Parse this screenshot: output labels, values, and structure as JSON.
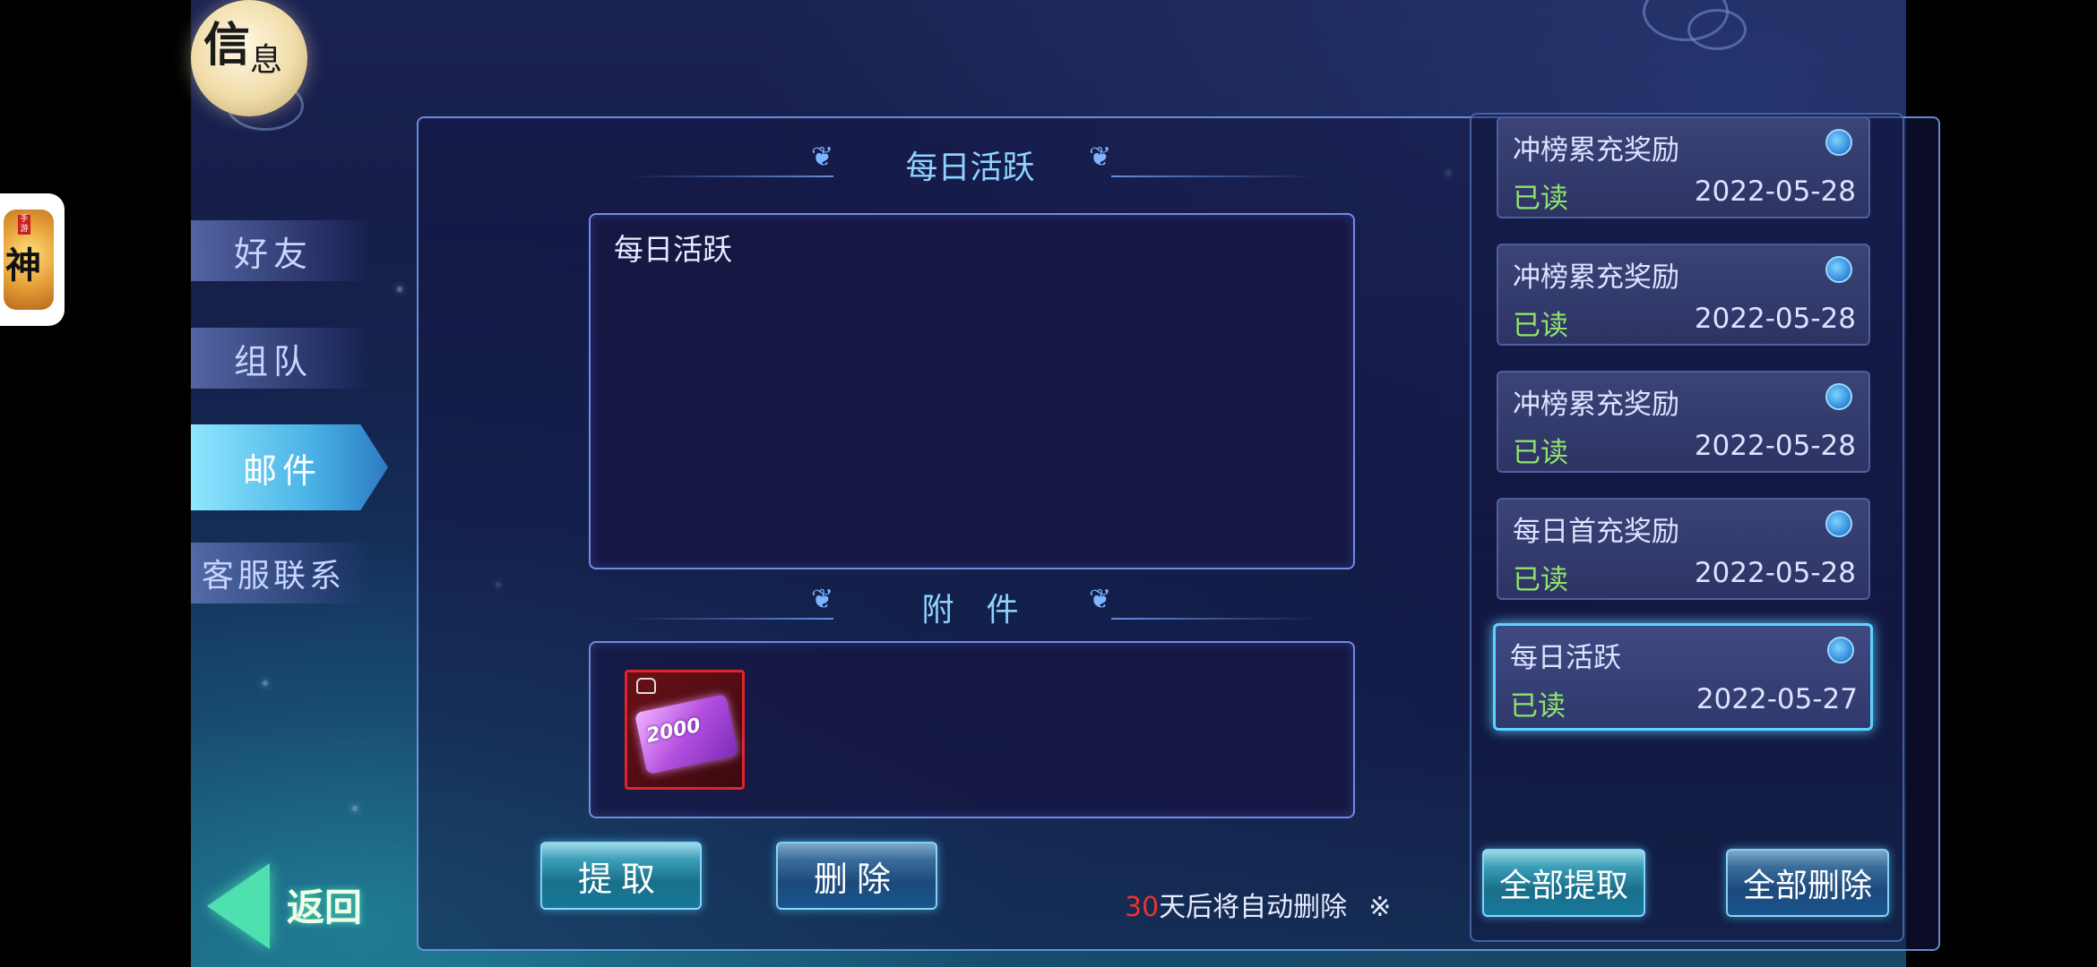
{
  "header": {
    "emblem_char1": "信",
    "emblem_char2": "息"
  },
  "app_icon": {
    "glyph": "神",
    "seal": "手游"
  },
  "tabs": [
    {
      "label": "好友",
      "active": false
    },
    {
      "label": "组队",
      "active": false
    },
    {
      "label": "邮件",
      "active": true
    },
    {
      "label": "客服联系",
      "active": false
    }
  ],
  "mail_detail": {
    "title": "每日活跃",
    "body": "每日活跃",
    "attachment_title": "附　件",
    "attachment_item": {
      "name": "2000充值券",
      "value": "2000",
      "icon": "purple-ticket-icon",
      "locked": true
    },
    "claim_label": "提取",
    "delete_label": "删除",
    "notice_days": "30",
    "notice_text": "天后将自动删除",
    "notice_mark": "※"
  },
  "mail_list": [
    {
      "title": "冲榜累充奖励",
      "status": "已读",
      "date": "2022-05-28",
      "selected": false
    },
    {
      "title": "冲榜累充奖励",
      "status": "已读",
      "date": "2022-05-28",
      "selected": false
    },
    {
      "title": "冲榜累充奖励",
      "status": "已读",
      "date": "2022-05-28",
      "selected": false
    },
    {
      "title": "每日首充奖励",
      "status": "已读",
      "date": "2022-05-28",
      "selected": false
    },
    {
      "title": "每日活跃",
      "status": "已读",
      "date": "2022-05-27",
      "selected": true
    }
  ],
  "list_actions": {
    "claim_all": "全部提取",
    "delete_all": "全部删除"
  },
  "back": {
    "label": "返回"
  },
  "colors": {
    "accent": "#8fd2ff",
    "read_status": "#8fe36a",
    "warning": "#e8332e",
    "selected_border": "#5fd3ff"
  }
}
